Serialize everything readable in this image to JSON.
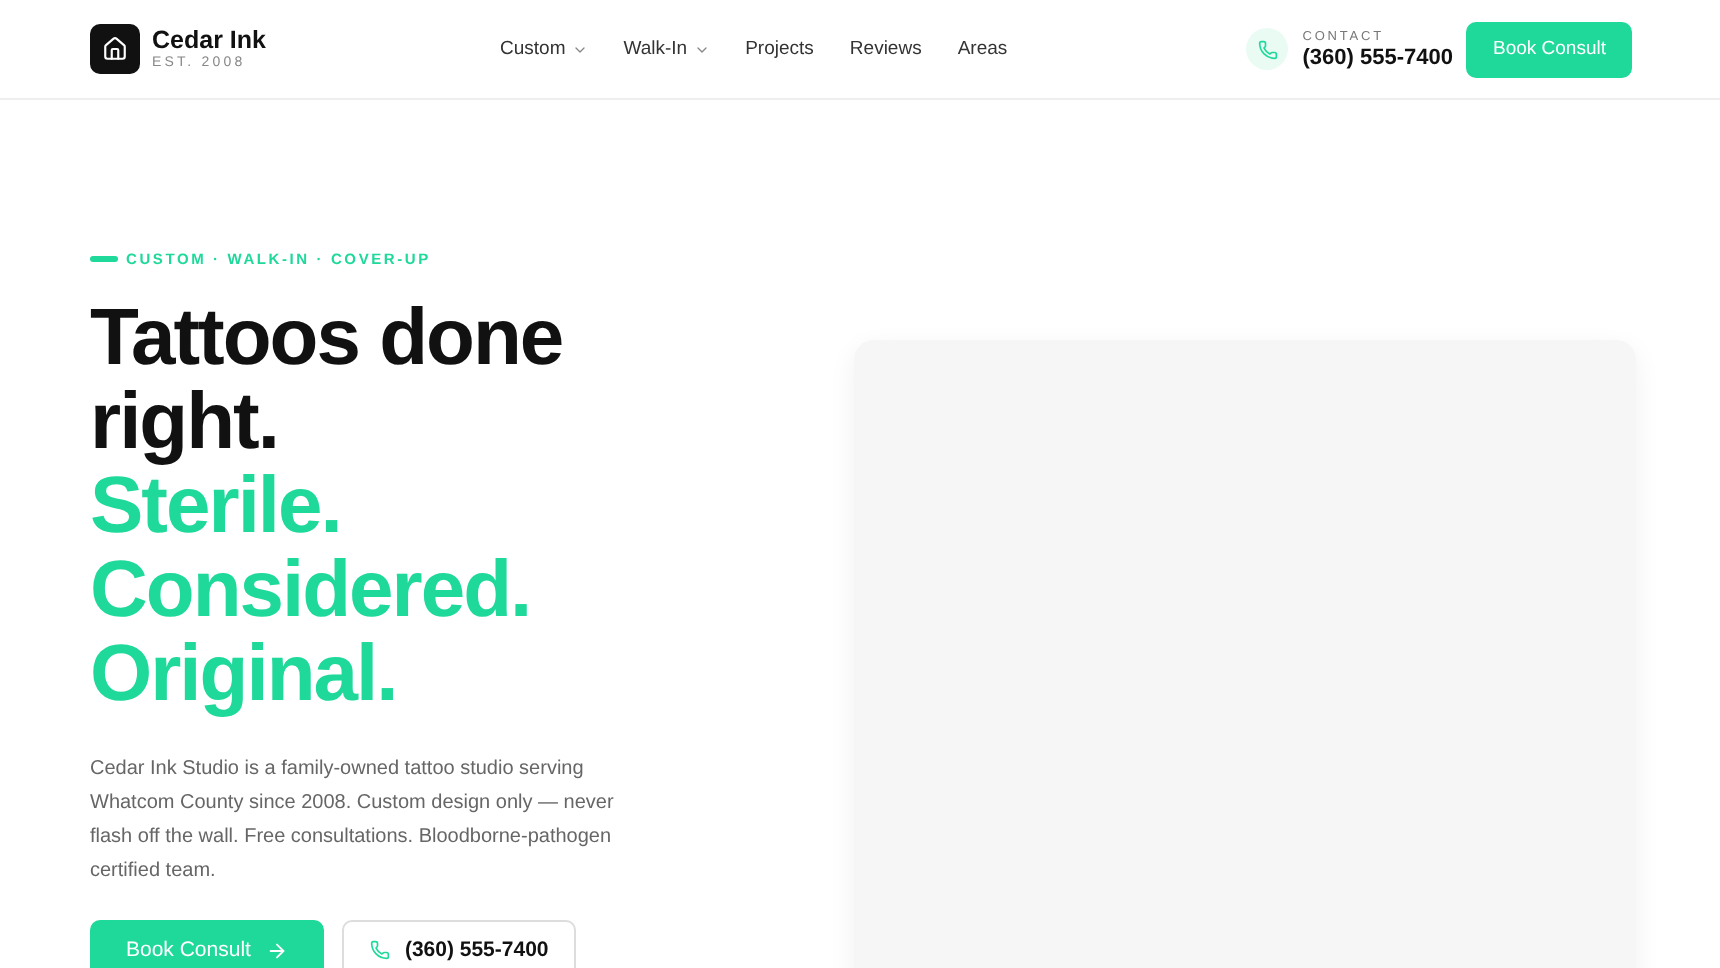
{
  "brand": {
    "name": "Cedar Ink",
    "tagline": "EST. 2008"
  },
  "nav": [
    {
      "label": "Custom",
      "has_menu": true
    },
    {
      "label": "Walk-In",
      "has_menu": true
    },
    {
      "label": "Projects",
      "has_menu": false
    },
    {
      "label": "Reviews",
      "has_menu": false
    },
    {
      "label": "Areas",
      "has_menu": false
    }
  ],
  "contact": {
    "label": "CONTACT",
    "phone": "(360) 555-7400"
  },
  "header_button": "Book Consult",
  "hero": {
    "eyebrow": "CUSTOM · WALK-IN · COVER-UP",
    "headline": "Tattoos done right.",
    "accent_lines": [
      "Sterile.",
      "Considered.",
      "Original."
    ],
    "description": "Cedar Ink Studio is a family-owned tattoo studio serving Whatcom County since 2008. Custom design only — never flash off the wall. Free consultations. Bloodborne-pathogen certified team.",
    "primary_button": "Book Consult",
    "phone_button": "(360) 555-7400"
  }
}
